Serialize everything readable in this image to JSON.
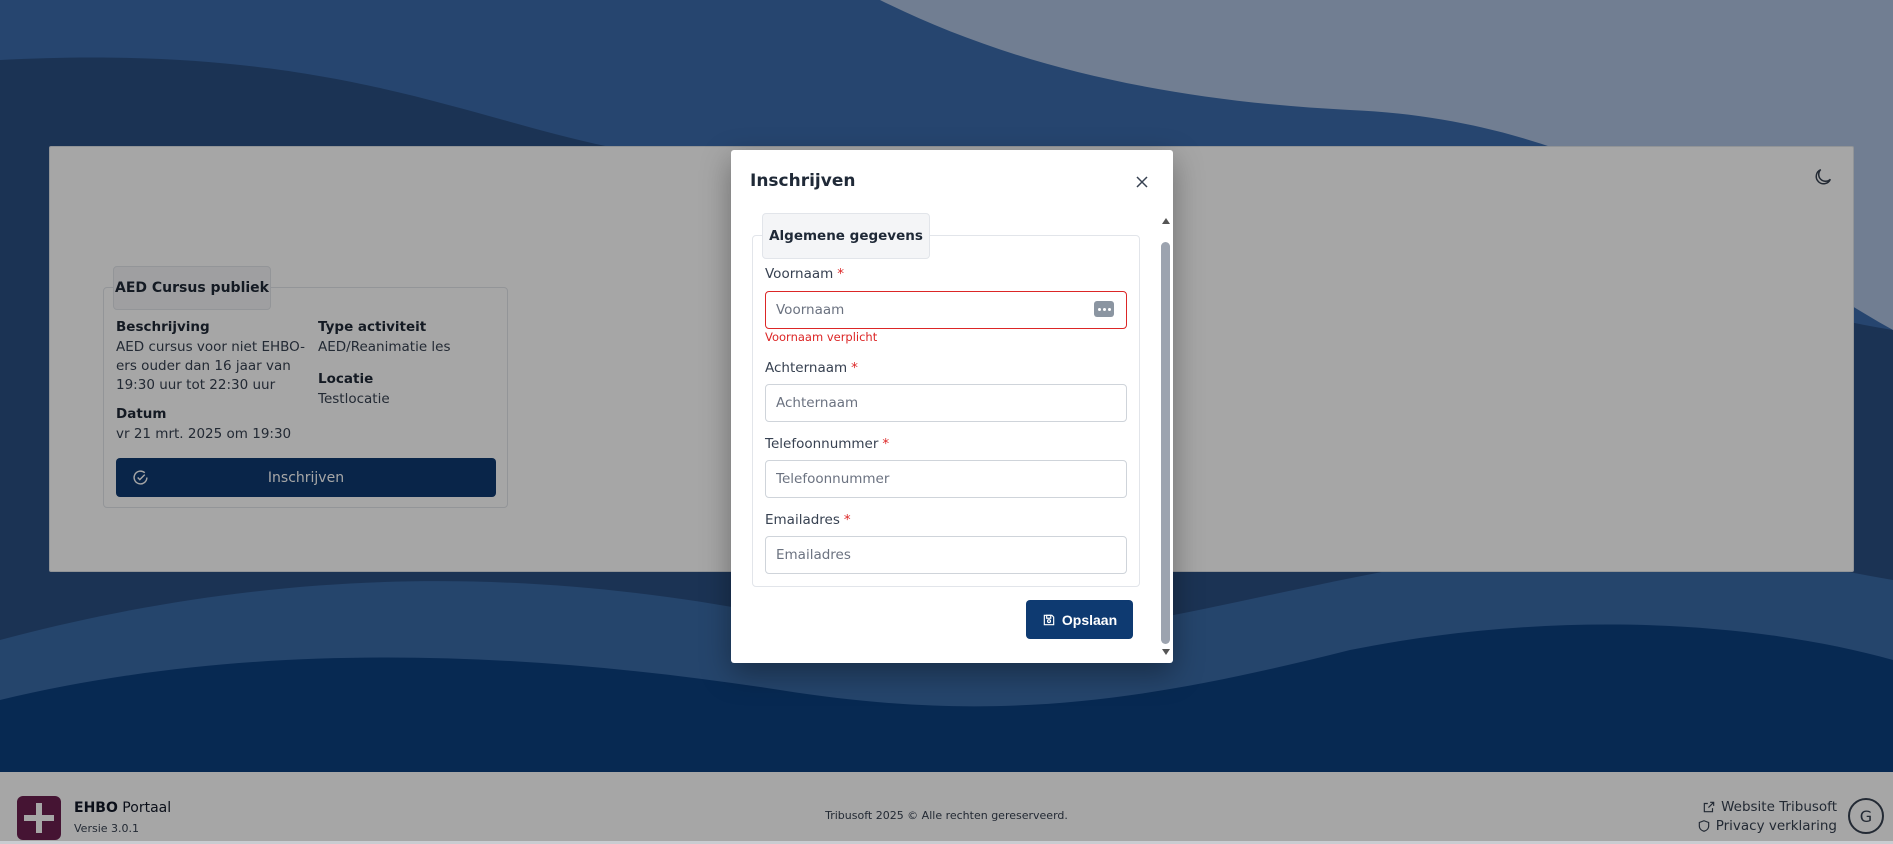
{
  "page": {
    "event_card": {
      "title": "AED Cursus publiek",
      "beschrijving_label": "Beschrijving",
      "beschrijving_lines": [
        "AED cursus voor niet EHBO-",
        "ers ouder dan 16 jaar van",
        "19:30 uur tot 22:30 uur"
      ],
      "type_label": "Type activiteit",
      "type_value": "AED/Reanimatie les",
      "locatie_label": "Locatie",
      "locatie_value": "Testlocatie",
      "datum_label": "Datum",
      "datum_value": "vr 21 mrt. 2025 om 19:30",
      "button_label": "Inschrijven"
    },
    "theme_toggle_icon": "moon-icon"
  },
  "modal": {
    "title": "Inschrijven",
    "section_title": "Algemene gegevens",
    "fields": {
      "voornaam": {
        "label": "Voornaam",
        "placeholder": "Voornaam",
        "value": "",
        "error": "Voornaam verplicht"
      },
      "achternaam": {
        "label": "Achternaam",
        "placeholder": "Achternaam",
        "value": ""
      },
      "telefoonnummer": {
        "label": "Telefoonnummer",
        "placeholder": "Telefoonnummer",
        "value": ""
      },
      "emailadres": {
        "label": "Emailadres",
        "placeholder": "Emailadres",
        "value": ""
      }
    },
    "required_marker": "*",
    "save_label": "Opslaan"
  },
  "footer": {
    "brand_bold": "EHBO",
    "brand_rest": " Portaal",
    "version": "Versie 3.0.1",
    "copyright": "Tribusoft 2025 © Alle rechten gereserveerd.",
    "links": {
      "website": "Website Tribusoft",
      "privacy": "Privacy verklaring"
    },
    "g_button": "G"
  },
  "colors": {
    "primary": "#0e3a71",
    "error": "#dc2626",
    "logo": "#6b1f4f"
  }
}
